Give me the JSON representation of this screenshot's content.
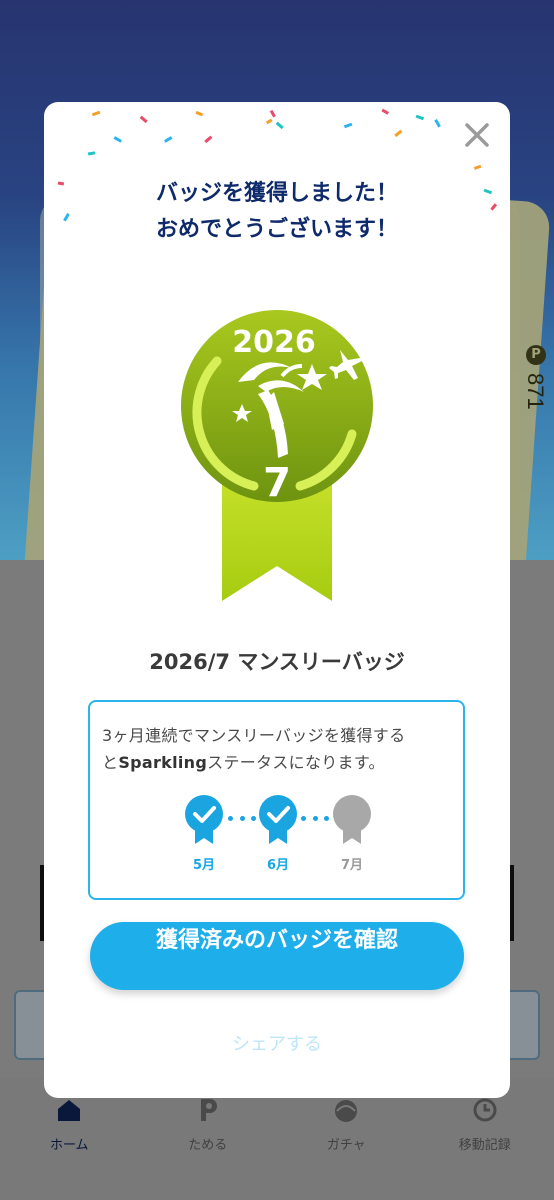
{
  "modal": {
    "title_line1": "バッジを獲得しました！",
    "title_line2": "おめでとうございます！",
    "badge": {
      "year": "2026",
      "month": "7"
    },
    "badge_name": "2026/7 マンスリーバッジ",
    "info_line1": "3ヶ月連続でマンスリーバッジを獲得する",
    "info_line2_pre": "と",
    "info_line2_bold": "Sparkling",
    "info_line2_post": "ステータスになります。",
    "progress": [
      {
        "label": "5月",
        "achieved": true
      },
      {
        "label": "6月",
        "achieved": true
      },
      {
        "label": "7月",
        "achieved": false
      }
    ],
    "cta_label": "獲得済みのバッジを確認",
    "share_label": "シェアする"
  },
  "background": {
    "points_value": "871"
  },
  "bottom_nav": {
    "items": [
      {
        "label": "ホーム",
        "icon": "home-icon",
        "active": true
      },
      {
        "label": "ためる",
        "icon": "point-icon",
        "active": false
      },
      {
        "label": "ガチャ",
        "icon": "gacha-icon",
        "active": false
      },
      {
        "label": "移動記録",
        "icon": "clock-icon",
        "active": false
      }
    ]
  },
  "colors": {
    "accent": "#1eaeea",
    "title": "#0f2a6b",
    "badge_green": "#9cc31a",
    "badge_light": "#d8f058",
    "inactive": "#a8a8a8"
  }
}
